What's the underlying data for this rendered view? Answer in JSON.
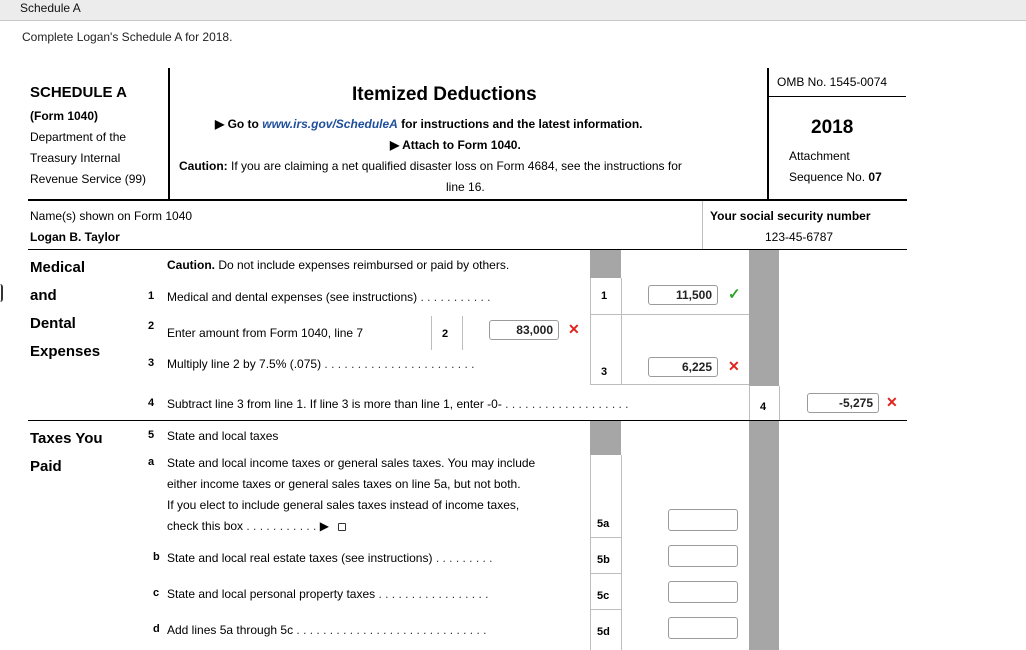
{
  "window": {
    "title": "Schedule A"
  },
  "instruction": "Complete Logan's Schedule A for 2018.",
  "header": {
    "schedule": "SCHEDULE A",
    "form": "(Form 1040)",
    "dept_lines": [
      "Department of the",
      "Treasury Internal",
      "Revenue Service (99)"
    ],
    "title": "Itemized Deductions",
    "goto_prefix": "▶ Go to ",
    "goto_link": "www.irs.gov/ScheduleA",
    "goto_suffix": " for instructions and the latest information.",
    "attach": "▶ Attach to Form 1040.",
    "caution_label": "Caution:",
    "caution_text": " If you are claiming a net qualified disaster loss on Form 4684, see the instructions for",
    "caution_line2": "line 16.",
    "omb": "OMB No. 1545-0074",
    "year": "2018",
    "attachment": "Attachment",
    "sequence_prefix": "Sequence No. ",
    "sequence_no": "07"
  },
  "identity": {
    "name_label": "Name(s) shown on Form 1040",
    "name_value": "Logan B. Taylor",
    "ssn_label": "Your social security number",
    "ssn_value": "123-45-6787"
  },
  "medical": {
    "section_words": [
      "Medical",
      "and",
      "Dental",
      "Expenses"
    ],
    "caution_label": "Caution.",
    "caution_text": " Do not include expenses reimbursed or paid by others.",
    "line1": {
      "num": "1",
      "text": "Medical and dental expenses (see instructions)",
      "box": "1",
      "value": "11,500",
      "status": "correct"
    },
    "line2": {
      "num": "2",
      "text": "Enter amount from Form 1040, line 7",
      "box": "2",
      "value": "83,000",
      "status": "incorrect"
    },
    "line3": {
      "num": "3",
      "text": "Multiply line 2 by 7.5% (.075)",
      "box": "3",
      "value": "6,225",
      "status": "incorrect"
    },
    "line4": {
      "num": "4",
      "text": "Subtract line 3 from line 1. If line 3 is more than line 1, enter -0-",
      "box": "4",
      "value": "-5,275",
      "status": "incorrect"
    }
  },
  "taxes": {
    "section_words": [
      "Taxes You",
      "Paid"
    ],
    "line5": {
      "num": "5",
      "text": "State and local taxes"
    },
    "line5a": {
      "num": "a",
      "lines": [
        "State and local income taxes or general sales taxes. You may include",
        "either income taxes or general sales taxes on line 5a, but not both.",
        "If you elect to include general sales taxes instead of income taxes,"
      ],
      "checkbox_text": "check this box",
      "box": "5a",
      "value": ""
    },
    "line5b": {
      "num": "b",
      "text": "State and local real estate taxes (see instructions)",
      "box": "5b",
      "value": ""
    },
    "line5c": {
      "num": "c",
      "text": "State and local personal property taxes",
      "box": "5c",
      "value": ""
    },
    "line5d": {
      "num": "d",
      "text": "Add lines 5a through 5c",
      "box": "5d",
      "value": ""
    }
  },
  "icons": {
    "correct": "check-icon",
    "incorrect": "x-icon",
    "pointer": "arrow-right-icon"
  },
  "colors": {
    "correct": "#2aa52a",
    "incorrect": "#e0231c",
    "link": "#1f4f9c",
    "shaded_column": "#a6a6a6"
  }
}
